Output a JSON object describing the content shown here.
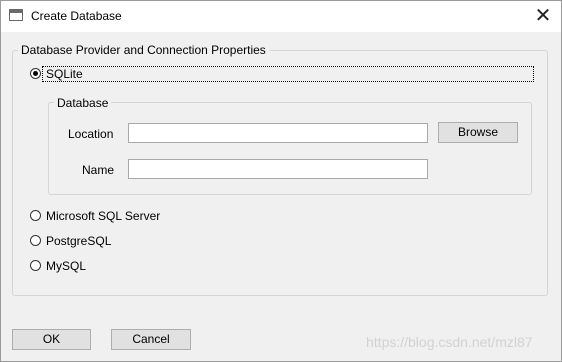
{
  "window": {
    "title": "Create Database",
    "close_glyph": "✕"
  },
  "provider_group": {
    "legend": "Database Provider and Connection Properties",
    "options": [
      {
        "label": "SQLite",
        "checked": true
      },
      {
        "label": "Microsoft SQL Server",
        "checked": false
      },
      {
        "label": "PostgreSQL",
        "checked": false
      },
      {
        "label": "MySQL",
        "checked": false
      }
    ]
  },
  "database_group": {
    "legend": "Database",
    "location_label": "Location",
    "location_value": "",
    "browse_label": "Browse",
    "name_label": "Name",
    "name_value": ""
  },
  "footer": {
    "ok_label": "OK",
    "cancel_label": "Cancel"
  },
  "watermark": "https://blog.csdn.net/mzl87"
}
